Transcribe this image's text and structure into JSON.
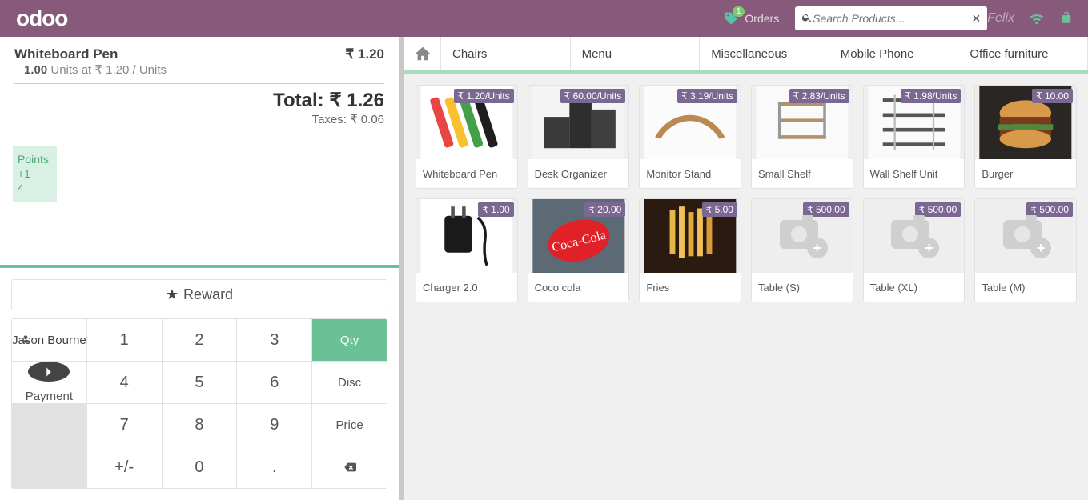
{
  "brand": "odoo",
  "orders_label": "Orders",
  "orders_count": "1",
  "search_placeholder": "Search Products...",
  "user_name": "Felix",
  "categories": [
    "Chairs",
    "Menu",
    "Miscellaneous",
    "Mobile Phone",
    "Office furniture"
  ],
  "points": {
    "label": "Points",
    "plus": "+1",
    "value": "4"
  },
  "order": {
    "product": "Whiteboard Pen",
    "line_price": "₹ 1.20",
    "qty": "1.00",
    "unit_text": "Units at",
    "unit_price": "₹ 1.20",
    "per": "/ Units",
    "total_label": "Total:",
    "total": "₹ 1.26",
    "tax_label": "Taxes:",
    "tax": "₹ 0.06"
  },
  "reward_label": "Reward",
  "customer": "Jason Bourne",
  "payment_label": "Payment",
  "modes": {
    "qty": "Qty",
    "disc": "Disc",
    "price": "Price"
  },
  "numpad": {
    "k1": "1",
    "k2": "2",
    "k3": "3",
    "k4": "4",
    "k5": "5",
    "k6": "6",
    "k7": "7",
    "k8": "8",
    "k9": "9",
    "k0": "0",
    "pm": "+/-",
    "dot": "."
  },
  "products": [
    {
      "name": "Whiteboard Pen",
      "price": "₹ 1.20/Units",
      "thumb": "pens"
    },
    {
      "name": "Desk Organizer",
      "price": "₹ 60.00/Units",
      "thumb": "organizer"
    },
    {
      "name": "Monitor Stand",
      "price": "₹ 3.19/Units",
      "thumb": "stand"
    },
    {
      "name": "Small Shelf",
      "price": "₹ 2.83/Units",
      "thumb": "shelf"
    },
    {
      "name": "Wall Shelf Unit",
      "price": "₹ 1.98/Units",
      "thumb": "wallshelf"
    },
    {
      "name": "Burger",
      "price": "₹ 10.00",
      "thumb": "burger"
    },
    {
      "name": "Charger 2.0",
      "price": "₹ 1.00",
      "thumb": "charger"
    },
    {
      "name": "Coco cola",
      "price": "₹ 20.00",
      "thumb": "cola"
    },
    {
      "name": "Fries",
      "price": "₹ 5.00",
      "thumb": "fries"
    },
    {
      "name": "Table (S)",
      "price": "₹ 500.00",
      "thumb": "placeholder"
    },
    {
      "name": "Table (XL)",
      "price": "₹ 500.00",
      "thumb": "placeholder"
    },
    {
      "name": "Table (M)",
      "price": "₹ 500.00",
      "thumb": "placeholder"
    }
  ]
}
